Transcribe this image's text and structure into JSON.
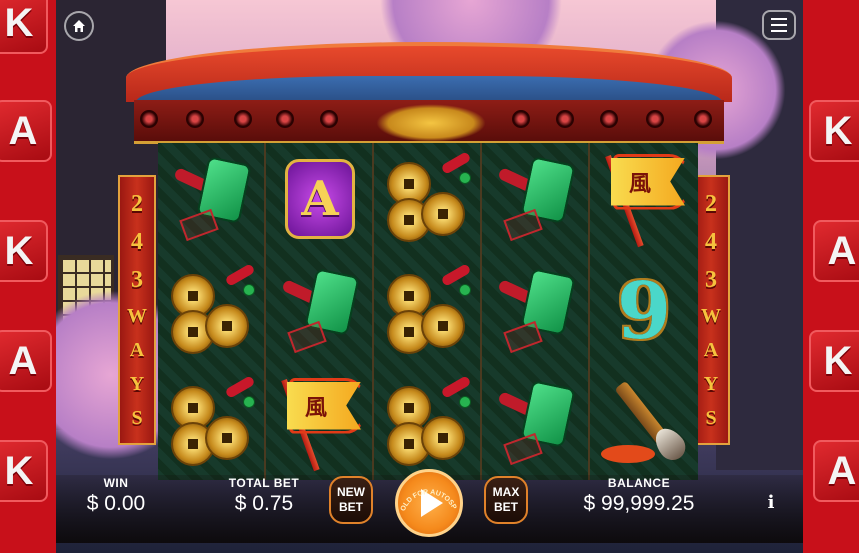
{
  "banners": {
    "left": [
      "2",
      "4",
      "3",
      "W",
      "A",
      "Y",
      "S"
    ],
    "right": [
      "2",
      "4",
      "3",
      "W",
      "A",
      "Y",
      "S"
    ]
  },
  "dice": {
    "left": [
      "K",
      "A",
      "K",
      "A",
      "K"
    ],
    "right": [
      "K",
      "A",
      "K",
      "A"
    ]
  },
  "symbols": {
    "flag_glyph": "風",
    "letter_a": "A",
    "nine": "9"
  },
  "reels": [
    [
      "jade",
      "coins",
      "coins"
    ],
    [
      "letter_a",
      "jade",
      "flag"
    ],
    [
      "coins",
      "coins",
      "coins"
    ],
    [
      "jade",
      "jade",
      "jade"
    ],
    [
      "flag",
      "nine",
      "brush"
    ]
  ],
  "hud": {
    "win_label": "WIN",
    "win_value": "$ 0.00",
    "total_bet_label": "TOTAL BET",
    "total_bet_value": "$ 0.75",
    "new_bet_line1": "NEW",
    "new_bet_line2": "BET",
    "hold_text": "HOLD FOR AUTOSPIN",
    "max_bet_line1": "MAX",
    "max_bet_line2": "BET",
    "balance_label": "BALANCE",
    "balance_value": "$ 99,999.25",
    "info_label": "i"
  },
  "icons": {
    "home": "home-icon",
    "menu": "menu-icon",
    "spin": "play-icon",
    "info": "info-icon"
  },
  "colors": {
    "frame_red": "#c8101a",
    "banner_gold": "#f6c23e",
    "spin_orange": "#f58a1c",
    "button_border": "#e0822a"
  }
}
